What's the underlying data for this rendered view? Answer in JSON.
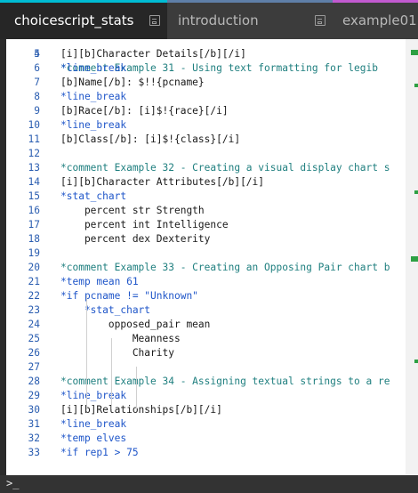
{
  "tabs": [
    {
      "label": "choicescript_stats"
    },
    {
      "label": "introduction"
    },
    {
      "label": "example01"
    }
  ],
  "editor": {
    "lines": [
      {
        "n": "5",
        "text": "[i][b]Character Details[/b][/i]"
      },
      {
        "n": "6",
        "text": "*line_break"
      },
      {
        "n": "7",
        "text": "[b]Name[/b]: $!!{pcname}"
      },
      {
        "n": "8",
        "text": "*line_break"
      },
      {
        "n": "9",
        "text": "[b]Race[/b]: [i]$!{race}[/i]"
      },
      {
        "n": "10",
        "text": "*line_break"
      },
      {
        "n": "11",
        "text": "[b]Class[/b]: [i]$!{class}[/i]"
      },
      {
        "n": "12",
        "text": ""
      },
      {
        "n": "13",
        "text": "*comment Example 32 - Creating a visual display chart s"
      },
      {
        "n": "14",
        "text": "[i][b]Character Attributes[/b][/i]"
      },
      {
        "n": "15",
        "text": "*stat_chart"
      },
      {
        "n": "16",
        "text": "    percent str Strength"
      },
      {
        "n": "17",
        "text": "    percent int Intelligence"
      },
      {
        "n": "18",
        "text": "    percent dex Dexterity"
      },
      {
        "n": "19",
        "text": ""
      },
      {
        "n": "20",
        "text": "*comment Example 33 - Creating an Opposing Pair chart b"
      },
      {
        "n": "21",
        "text": "*temp mean 61"
      },
      {
        "n": "22",
        "text": "*if pcname != \"Unknown\""
      },
      {
        "n": "23",
        "text": "    *stat_chart"
      },
      {
        "n": "24",
        "text": "        opposed_pair mean"
      },
      {
        "n": "25",
        "text": "            Meanness"
      },
      {
        "n": "26",
        "text": "            Charity"
      },
      {
        "n": "27",
        "text": ""
      },
      {
        "n": "28",
        "text": "*comment Example 34 - Assigning textual strings to a re"
      },
      {
        "n": "29",
        "text": "*line_break"
      },
      {
        "n": "30",
        "text": "[i][b]Relationships[/b][/i]"
      },
      {
        "n": "31",
        "text": "*line_break"
      },
      {
        "n": "32",
        "text": "*temp elves"
      },
      {
        "n": "33",
        "text": "*if rep1 > 75"
      }
    ]
  },
  "console": {
    "prompt": ">_"
  },
  "colors": {
    "accent_active_tab": "#00bcd4",
    "accent_tab2": "#5f7fa8",
    "accent_tab3": "#c25ad0"
  }
}
